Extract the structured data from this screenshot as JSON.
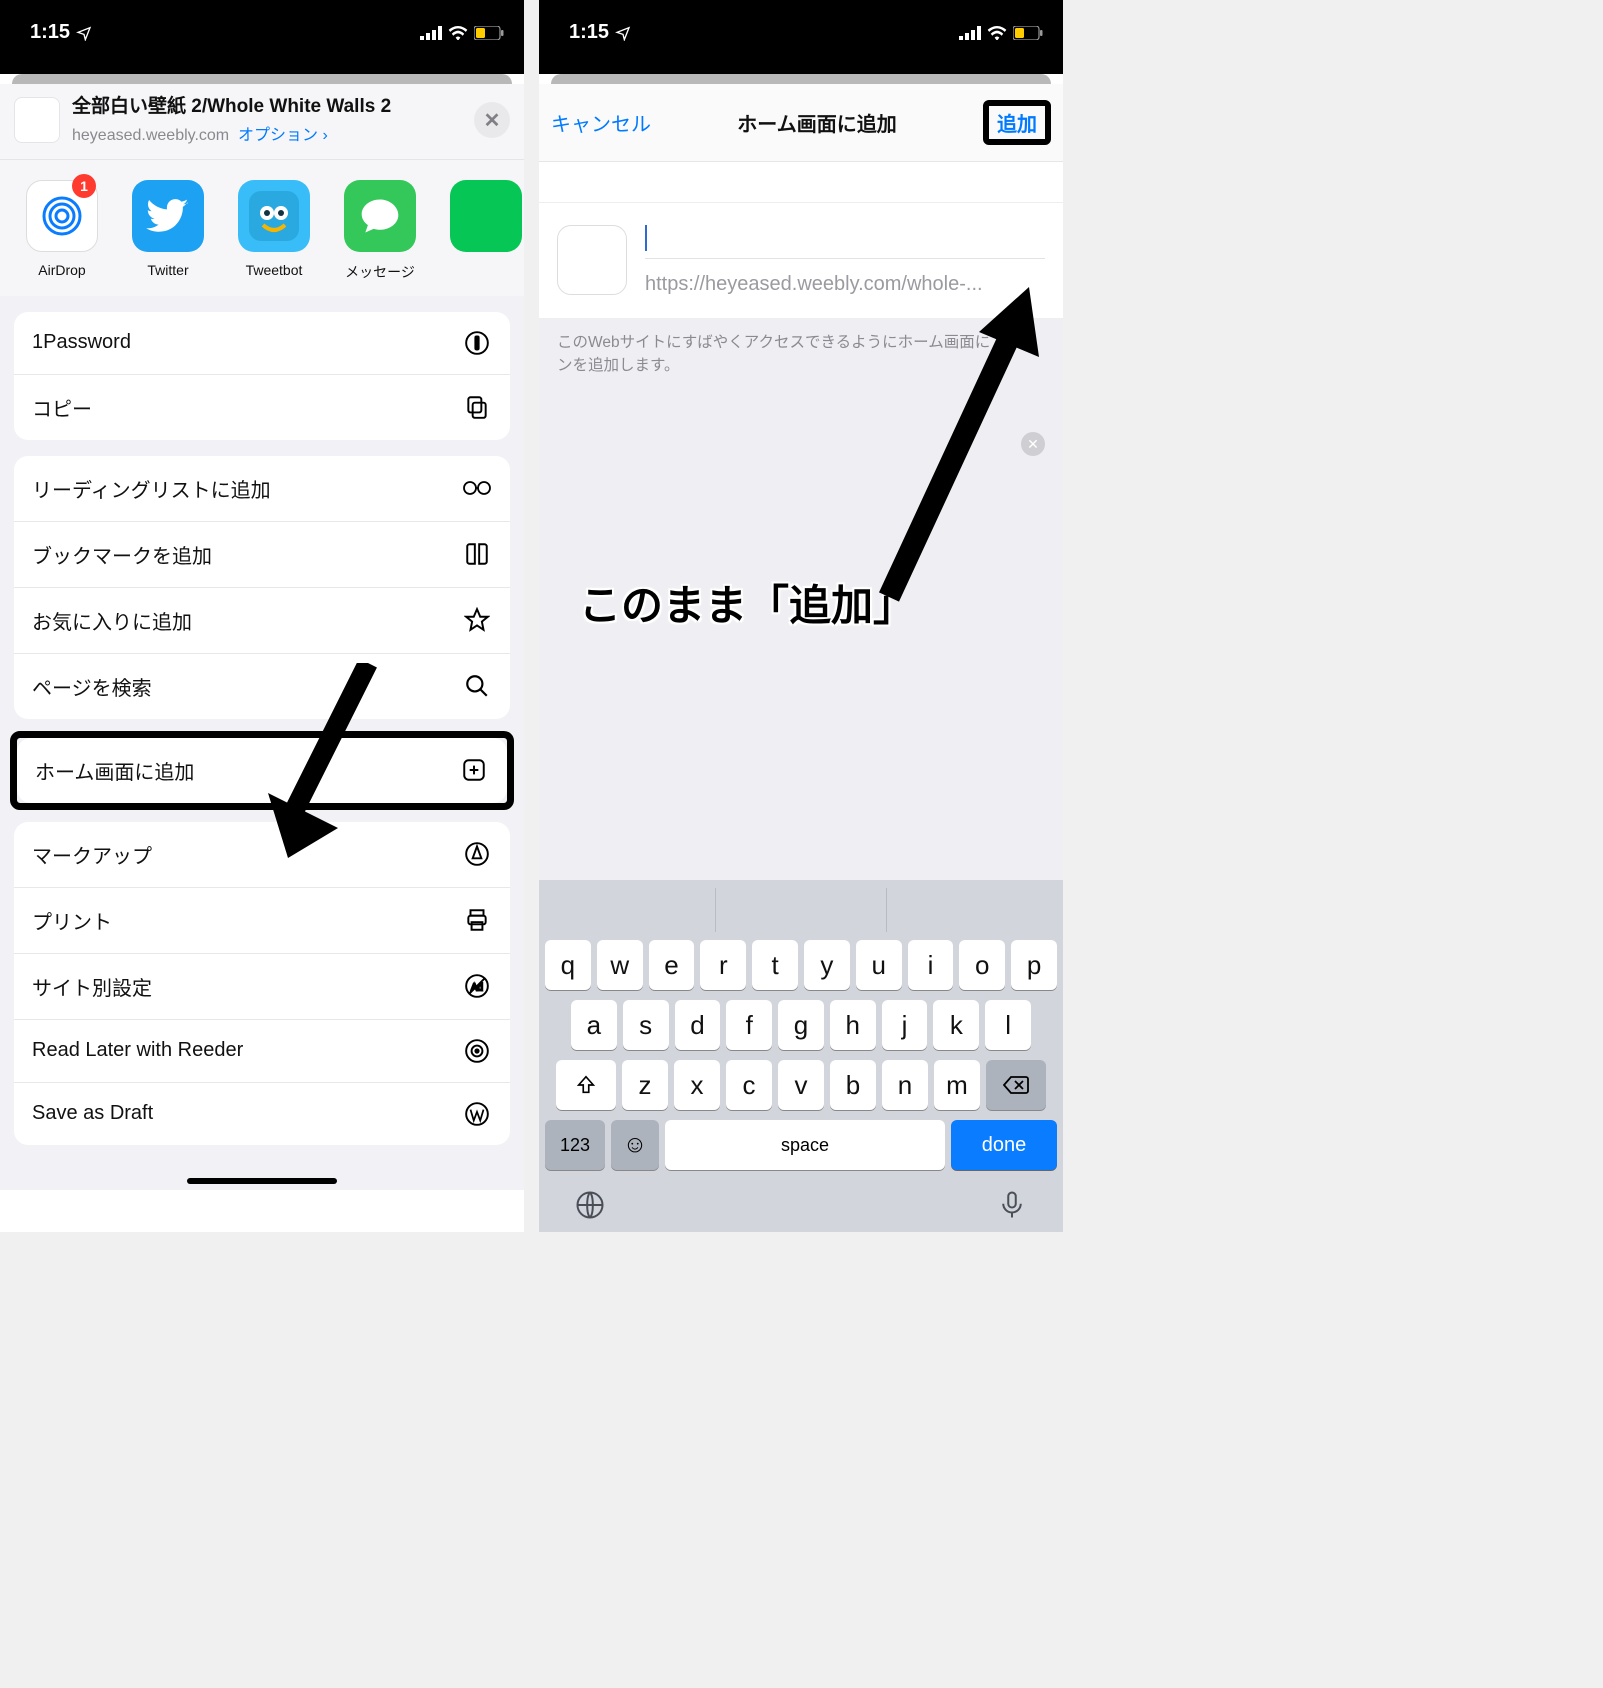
{
  "status": {
    "time": "1:15",
    "battery_low_color": "#ffcc00"
  },
  "left": {
    "page_title": "全部白い壁紙 2/Whole White Walls 2",
    "page_domain": "heyeased.weebly.com",
    "options_label": "オプション",
    "apps": [
      {
        "name": "AirDrop",
        "label": "AirDrop",
        "badge": "1",
        "bg": "#ffffff"
      },
      {
        "name": "Twitter",
        "label": "Twitter",
        "bg": "#1da1f2"
      },
      {
        "name": "Tweetbot",
        "label": "Tweetbot",
        "bg": "#38bdf8"
      },
      {
        "name": "Messages",
        "label": "メッセージ",
        "bg": "#34c759"
      },
      {
        "name": "LINE",
        "label": "",
        "bg": "#06c755"
      }
    ],
    "group1": [
      {
        "label": "1Password",
        "icon": "onepassword"
      },
      {
        "label": "コピー",
        "icon": "copy"
      }
    ],
    "group2": [
      {
        "label": "リーディングリストに追加",
        "icon": "glasses"
      },
      {
        "label": "ブックマークを追加",
        "icon": "book"
      },
      {
        "label": "お気に入りに追加",
        "icon": "star"
      },
      {
        "label": "ページを検索",
        "icon": "search"
      },
      {
        "label": "ホーム画面に追加",
        "icon": "plus-square",
        "highlight": true
      },
      {
        "label": "マークアップ",
        "icon": "markup"
      },
      {
        "label": "プリント",
        "icon": "print"
      },
      {
        "label": "サイト別設定",
        "icon": "noads"
      },
      {
        "label": "Read Later with Reeder",
        "icon": "reeder"
      },
      {
        "label": "Save as Draft",
        "icon": "wordpress"
      }
    ]
  },
  "right": {
    "cancel": "キャンセル",
    "title": "ホーム画面に追加",
    "add": "追加",
    "url": "https://heyeased.weebly.com/whole-...",
    "hint": "このWebサイトにすばやくアクセスできるようにホーム画面にアイコンを追加します。",
    "caption": "このまま「追加」",
    "keyboard": {
      "row1": [
        "q",
        "w",
        "e",
        "r",
        "t",
        "y",
        "u",
        "i",
        "o",
        "p"
      ],
      "row2": [
        "a",
        "s",
        "d",
        "f",
        "g",
        "h",
        "j",
        "k",
        "l"
      ],
      "row3": [
        "z",
        "x",
        "c",
        "v",
        "b",
        "n",
        "m"
      ],
      "numeric_label": "123",
      "space_label": "space",
      "done_label": "done"
    }
  }
}
